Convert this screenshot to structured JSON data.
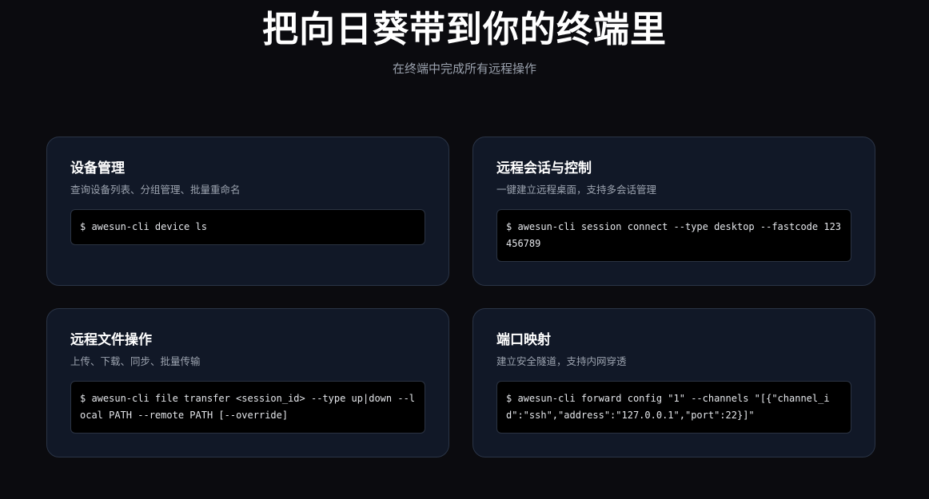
{
  "hero": {
    "title": "把向日葵带到你的终端里",
    "subtitle": "在终端中完成所有远程操作"
  },
  "cards": [
    {
      "title": "设备管理",
      "description": "查询设备列表、分组管理、批量重命名",
      "command": "$ awesun-cli device ls"
    },
    {
      "title": "远程会话与控制",
      "description": "一键建立远程桌面，支持多会话管理",
      "command": "$ awesun-cli session connect --type desktop --fastcode 123456789"
    },
    {
      "title": "远程文件操作",
      "description": "上传、下载、同步、批量传输",
      "command": "$ awesun-cli file transfer <session_id> --type up|down --local PATH --remote PATH [--override]"
    },
    {
      "title": "端口映射",
      "description": "建立安全隧道，支持内网穿透",
      "command": "$ awesun-cli forward config \"1\" --channels \"[{\"channel_id\":\"ssh\",\"address\":\"127.0.0.1\",\"port\":22}]\""
    }
  ],
  "colors": {
    "background": "#0b0b0f",
    "card_background": "#111827",
    "card_border": "#2a3446",
    "code_background": "#000000"
  }
}
